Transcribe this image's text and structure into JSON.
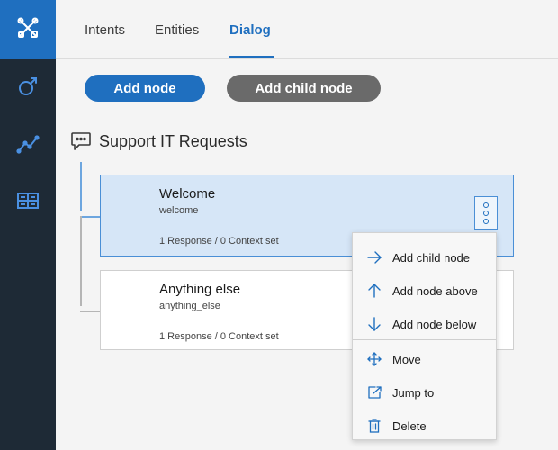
{
  "sidebar": {
    "items": [
      {
        "icon": "tools-icon",
        "active": true
      },
      {
        "icon": "deploy-icon",
        "active": false
      },
      {
        "icon": "analytics-icon",
        "active": false
      },
      {
        "icon": "workspace-grid-icon",
        "active": false
      }
    ]
  },
  "tabs": [
    {
      "label": "Intents",
      "active": false
    },
    {
      "label": "Entities",
      "active": false
    },
    {
      "label": "Dialog",
      "active": true
    }
  ],
  "toolbar": {
    "add_node_label": "Add node",
    "add_child_node_label": "Add child node"
  },
  "dialog": {
    "title": "Support IT Requests",
    "nodes": [
      {
        "name": "Welcome",
        "condition": "welcome",
        "meta": "1 Response / 0 Context set",
        "selected": true
      },
      {
        "name": "Anything else",
        "condition": "anything_else",
        "meta": "1 Response / 0 Context set",
        "selected": false
      }
    ]
  },
  "context_menu": {
    "items": [
      {
        "label": "Add child node",
        "icon": "arrow-right-icon"
      },
      {
        "label": "Add node above",
        "icon": "arrow-up-icon"
      },
      {
        "label": "Add node below",
        "icon": "arrow-down-icon"
      },
      {
        "label": "Move",
        "icon": "move-icon"
      },
      {
        "label": "Jump to",
        "icon": "jump-to-icon"
      },
      {
        "label": "Delete",
        "icon": "trash-icon"
      }
    ]
  },
  "colors": {
    "accent": "#1f6fbf",
    "sidebar_bg": "#1e2a36",
    "selected_node_bg": "#d6e6f7",
    "secondary_button": "#6a6a6a"
  }
}
